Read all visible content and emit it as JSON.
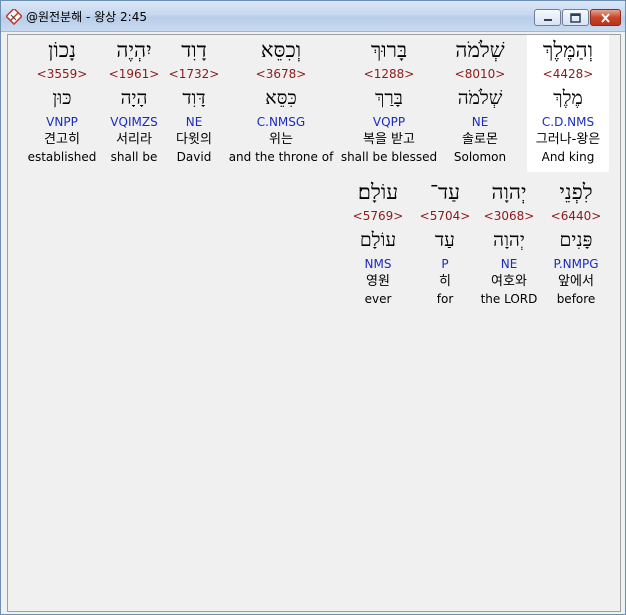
{
  "window": {
    "title": "@원전분해 - 왕상 2:45",
    "controls": {
      "minimize": "minimize",
      "maximize": "maximize",
      "close": "close"
    }
  },
  "rows": [
    [
      {
        "hebrew": "וְהַמֶּלֶךְ",
        "strong": "<4428>",
        "lemma": "מֶלֶךְ",
        "parse": "C.D.NMS",
        "korean": "그러나-왕은",
        "english": "And king",
        "selected": true
      },
      {
        "hebrew": "שְׁלֹמֹה",
        "strong": "<8010>",
        "lemma": "שְׁלֹמֹה",
        "parse": "NE",
        "korean": "솔로몬",
        "english": "Solomon"
      },
      {
        "hebrew": "בָּרוּךְ",
        "strong": "<1288>",
        "lemma": "בָּרַךְ",
        "parse": "VQPP",
        "korean": "복을 받고",
        "english": "shall be blessed"
      },
      {
        "hebrew": "וְכִסֵּא",
        "strong": "<3678>",
        "lemma": "כִּסֵּא",
        "parse": "C.NMSG",
        "korean": "위는",
        "english": "and the throne of"
      },
      {
        "hebrew": "דָוִד",
        "strong": "<1732>",
        "lemma": "דָּוִד",
        "parse": "NE",
        "korean": "다윗의",
        "english": "David"
      },
      {
        "hebrew": "יִהְיֶה",
        "strong": "<1961>",
        "lemma": "הָיָה",
        "parse": "VQIMZS",
        "korean": "서리라",
        "english": "shall be"
      },
      {
        "hebrew": "נָכוֹן",
        "strong": "<3559>",
        "lemma": "כּוּן",
        "parse": "VNPP",
        "korean": "견고히",
        "english": "established"
      }
    ],
    [
      {
        "hebrew": "לִפְנֵי",
        "strong": "<6440>",
        "lemma": "פָּנִים",
        "parse": "P.NMPG",
        "korean": "앞에서",
        "english": "before"
      },
      {
        "hebrew": "יְהוָה",
        "strong": "<3068>",
        "lemma": "יְהוָה",
        "parse": "NE",
        "korean": "여호와",
        "english": "the LORD"
      },
      {
        "hebrew": "עַד־",
        "strong": "<5704>",
        "lemma": "עַד",
        "parse": "P",
        "korean": "히",
        "english": "for"
      },
      {
        "hebrew": "עוֹלָם׃",
        "strong": "<5769>",
        "lemma": "עוֹלָם",
        "parse": "NMS",
        "korean": "영원",
        "english": "ever"
      }
    ]
  ],
  "colors": {
    "strong": "#8b1a1a",
    "parse": "#1a2bbf",
    "selected_bg": "#ffffff"
  }
}
